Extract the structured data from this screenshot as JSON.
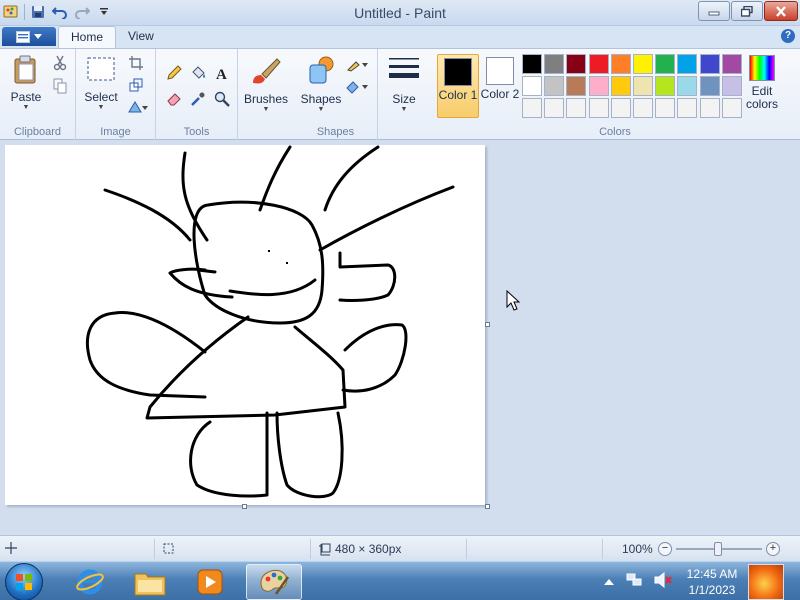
{
  "window": {
    "title": "Untitled - Paint"
  },
  "tabs": [
    {
      "label": "Home"
    },
    {
      "label": "View"
    }
  ],
  "help_label": "?",
  "ribbon": {
    "clipboard": {
      "group_label": "Clipboard",
      "paste_label": "Paste"
    },
    "image": {
      "group_label": "Image",
      "select_label": "Select"
    },
    "tools": {
      "group_label": "Tools"
    },
    "brushes_label": "Brushes",
    "shapes": {
      "group_label": "Shapes",
      "shapes_label": "Shapes"
    },
    "size_label": "Size",
    "colors": {
      "group_label": "Colors",
      "color1_label": "Color 1",
      "color1_value": "#000000",
      "color2_label": "Color 2",
      "color2_value": "#ffffff",
      "edit_label": "Edit colors",
      "palette": [
        "#000000",
        "#7f7f7f",
        "#880015",
        "#ed1c24",
        "#ff7f27",
        "#fff200",
        "#22b14c",
        "#00a2e8",
        "#3f48cc",
        "#a349a4",
        "#ffffff",
        "#c3c3c3",
        "#b97a57",
        "#ffaec9",
        "#ffc90e",
        "#efe4b0",
        "#b5e61d",
        "#99d9ea",
        "#7092be",
        "#c8bfe7",
        "#f3f3f3",
        "#f3f3f3",
        "#f3f3f3",
        "#f3f3f3",
        "#f3f3f3",
        "#f3f3f3",
        "#f3f3f3",
        "#f3f3f3",
        "#f3f3f3",
        "#f3f3f3"
      ]
    }
  },
  "canvas": {
    "background": "#ffffff",
    "stroke_color": "#000000"
  },
  "status": {
    "size_text": "480 × 360px",
    "zoom_text": "100%"
  },
  "taskbar": {
    "pinned": [
      "internet-explorer-icon",
      "file-explorer-icon",
      "media-player-icon",
      "paint-icon"
    ],
    "time": "12:45 AM",
    "date": "1/1/2023"
  }
}
